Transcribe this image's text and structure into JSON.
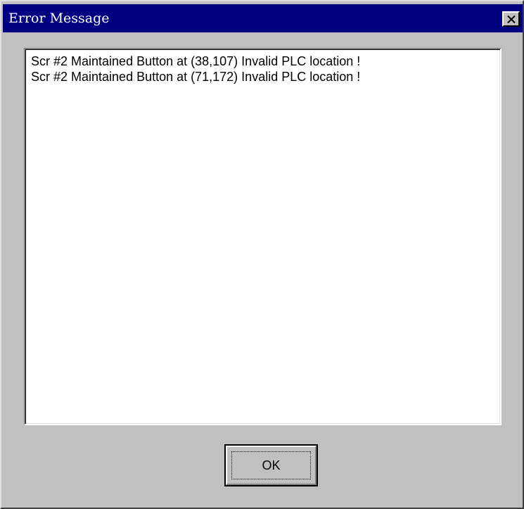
{
  "window": {
    "title": "Error Message",
    "close_icon": "close-icon"
  },
  "messages": [
    "Scr #2 Maintained Button at (38,107) Invalid PLC location !",
    "Scr #2 Maintained Button at (71,172) Invalid PLC location !"
  ],
  "buttons": {
    "ok_label": "OK"
  },
  "colors": {
    "titlebar": "#000080",
    "face": "#c0c0c0"
  }
}
